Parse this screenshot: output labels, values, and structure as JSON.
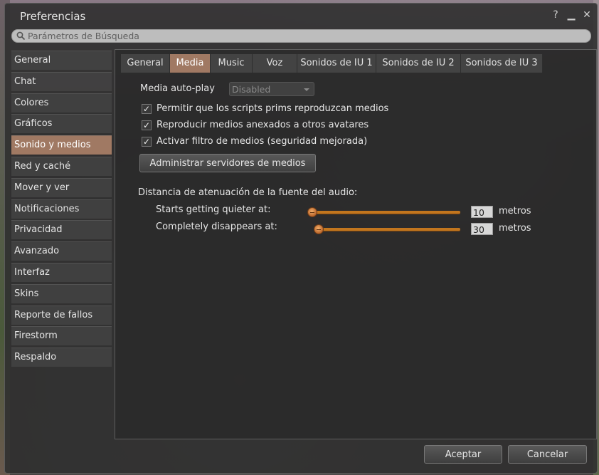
{
  "window": {
    "title": "Preferencias",
    "help_icon": "?",
    "minimize_icon": "▁",
    "close_icon": "✕"
  },
  "search": {
    "placeholder": "Parámetros de Búsqueda"
  },
  "sidebar": {
    "items": [
      {
        "label": "General"
      },
      {
        "label": "Chat"
      },
      {
        "label": "Colores"
      },
      {
        "label": "Gráficos"
      },
      {
        "label": "Sonido y medios"
      },
      {
        "label": "Red y caché"
      },
      {
        "label": "Mover y ver"
      },
      {
        "label": "Notificaciones"
      },
      {
        "label": "Privacidad"
      },
      {
        "label": "Avanzado"
      },
      {
        "label": "Interfaz"
      },
      {
        "label": "Skins"
      },
      {
        "label": "Reporte de fallos"
      },
      {
        "label": "Firestorm"
      },
      {
        "label": "Respaldo"
      }
    ],
    "active_index": 4
  },
  "tabs": [
    {
      "label": "General"
    },
    {
      "label": "Media"
    },
    {
      "label": "Music"
    },
    {
      "label": "Voz"
    },
    {
      "label": "Sonidos de IU 1"
    },
    {
      "label": "Sonidos de IU 2"
    },
    {
      "label": "Sonidos de IU 3"
    }
  ],
  "media": {
    "autoplay_label": "Media auto-play",
    "autoplay_value": "Disabled",
    "checkboxes": [
      {
        "label": "Permitir que los scripts prims reproduzcan medios",
        "checked": true
      },
      {
        "label": "Reproducir medios anexados a otros avatares",
        "checked": true
      },
      {
        "label": "Activar filtro de medios (seguridad mejorada)",
        "checked": true
      }
    ],
    "manage_servers_button": "Administrar servidores de medios",
    "attenuation_label": "Distancia de atenuación de la fuente del audio:",
    "sliders": [
      {
        "label": "Starts getting quieter at:",
        "value": "10",
        "unit": "metros"
      },
      {
        "label": "Completely disappears at:",
        "value": "30",
        "unit": "metros"
      }
    ]
  },
  "footer": {
    "accept_button": "Aceptar",
    "cancel_button": "Cancelar"
  }
}
